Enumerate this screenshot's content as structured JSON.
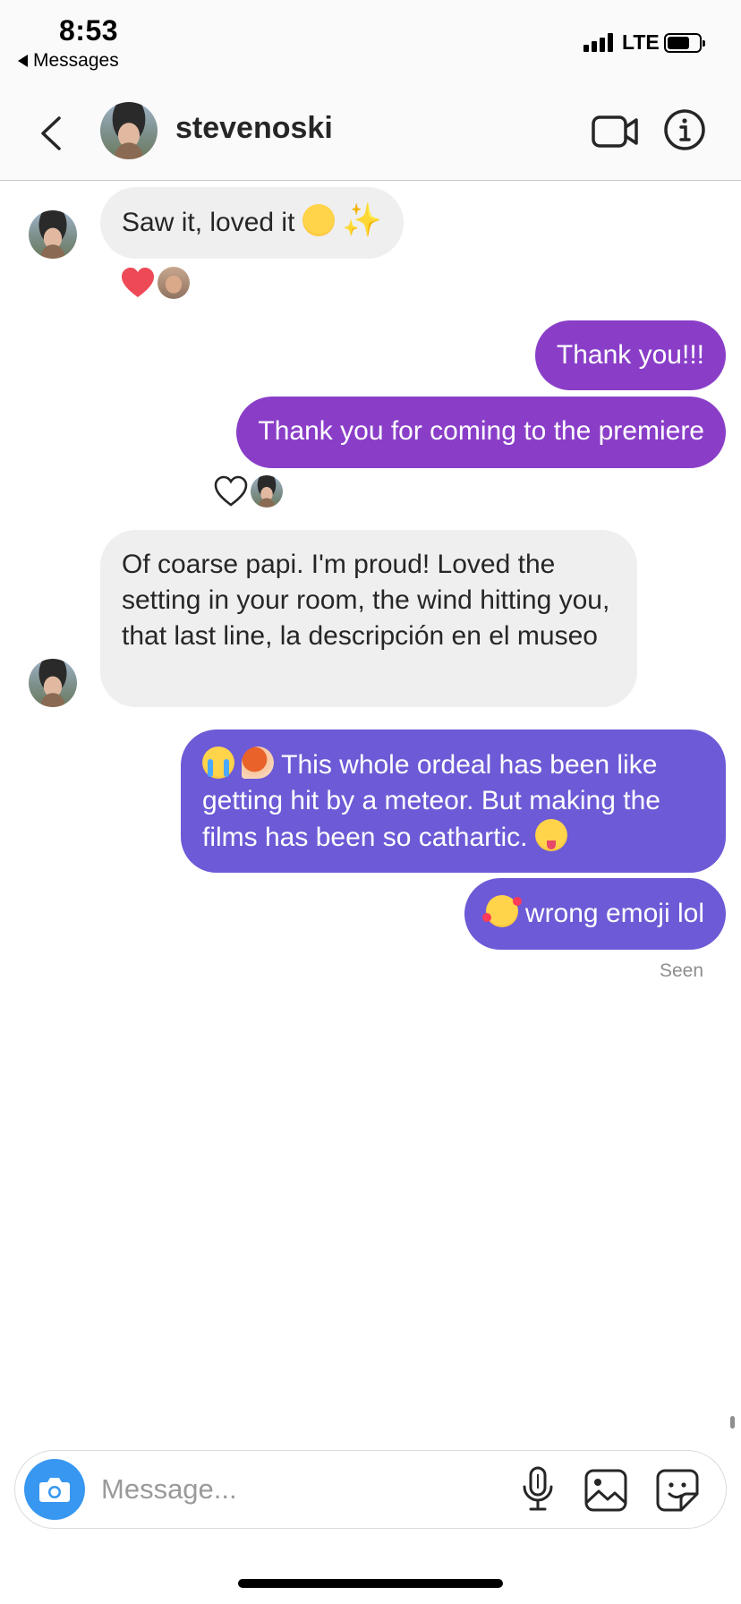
{
  "status_bar": {
    "time": "8:53",
    "back_app": "Messages",
    "network": "LTE",
    "battery_level": 0.72
  },
  "header": {
    "username": "stevenoski",
    "back_icon": "chevron-left-icon",
    "video_icon": "video-camera-icon",
    "info_icon": "info-icon"
  },
  "messages": [
    {
      "sender": "them",
      "text": "Saw it, loved it",
      "emojis": [
        "hugging-face",
        "sparkles"
      ]
    },
    {
      "sender": "me",
      "text": "Thank you!!!"
    },
    {
      "sender": "me",
      "text": "Thank you for coming to the premiere"
    },
    {
      "sender": "them",
      "text": "Of coarse papi. I'm proud! Loved the setting in your room, the wind hitting you, that last line, la descripción en el museo"
    },
    {
      "sender": "me",
      "text_before": "This whole ordeal has been like getting hit by a meteor. But making the films has been so cathartic.",
      "emojis": [
        "loudly-crying-face",
        "comet",
        "winking-tongue-face"
      ]
    },
    {
      "sender": "me",
      "text": "wrong emoji lol",
      "emojis": [
        "smiling-face-with-hearts"
      ]
    }
  ],
  "reactions": [
    {
      "message_index": 0,
      "icon": "heart-filled-icon",
      "color": "#ed4956"
    },
    {
      "message_index": 2,
      "icon": "heart-outline-icon"
    }
  ],
  "seen_label": "Seen",
  "composer": {
    "placeholder": "Message...",
    "camera_icon": "camera-icon",
    "mic_icon": "microphone-icon",
    "gallery_icon": "image-icon",
    "sticker_icon": "sticker-icon"
  },
  "colors": {
    "incoming_bubble": "#efefef",
    "outgoing_bubble_top": "#8a3ec8",
    "outgoing_bubble_bottom": "#6c5ad6",
    "camera_button": "#3897f0",
    "heart": "#ed4956"
  }
}
